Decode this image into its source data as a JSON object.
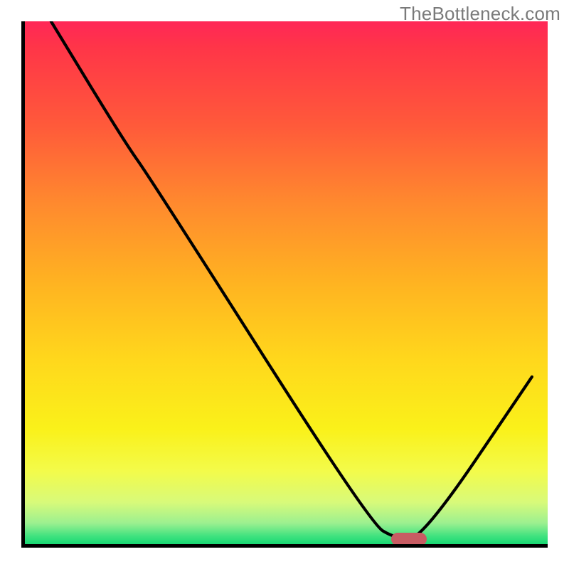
{
  "watermark": "TheBottleneck.com",
  "chart_data": {
    "type": "line",
    "title": "",
    "xlabel": "",
    "ylabel": "",
    "xlim": [
      0,
      100
    ],
    "ylim": [
      0,
      100
    ],
    "note": "Axes are unlabeled in the source image; values are normalized 0–100 estimates read from pixel positions.",
    "series": [
      {
        "name": "bottleneck-curve",
        "x": [
          5,
          19,
          24,
          66,
          71,
          76,
          97
        ],
        "y": [
          100,
          77,
          70,
          4,
          1,
          1,
          32
        ]
      }
    ],
    "marker": {
      "x": 73.5,
      "y": 1,
      "width_pct": 6.8,
      "color": "#c85c63"
    },
    "gradient_colors": {
      "top": "#ff2757",
      "mid_upper": "#ff8a2e",
      "mid": "#ffd81c",
      "mid_lower": "#f3fb4a",
      "bottom": "#18d874"
    }
  }
}
